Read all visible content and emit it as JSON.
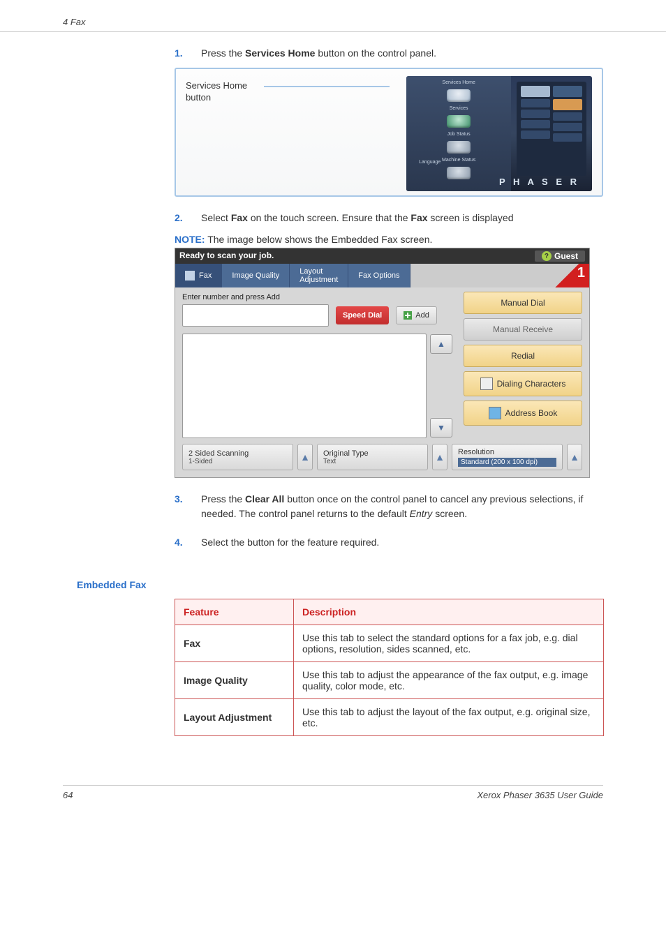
{
  "header": {
    "section": "4 Fax"
  },
  "steps": {
    "s1": {
      "num": "1.",
      "pre": "Press the ",
      "bold1": "Services Home",
      "post": " button on the control panel."
    },
    "s2": {
      "num": "2.",
      "pre": "Select ",
      "bold1": "Fax",
      "mid": " on the touch screen. Ensure that the ",
      "bold2": "Fax",
      "post": " screen is displayed"
    },
    "s3": {
      "num": "3.",
      "pre": "Press the ",
      "bold1": "Clear All",
      "mid": " button once on the control panel to cancel any previous selections, if needed. The control panel returns to the default ",
      "ital": "Entry",
      "post": " screen."
    },
    "s4": {
      "num": "4.",
      "text": "Select the button for the feature required."
    }
  },
  "photo": {
    "label_l1": "Services Home",
    "label_l2": "button",
    "panel_labels": {
      "svc_home": "Services Home",
      "services": "Services",
      "job_status": "Job Status",
      "machine_status": "Machine Status",
      "language": "Language"
    },
    "brand": "P H A S E R"
  },
  "note": {
    "label": "NOTE:",
    "text": " The image below shows the Embedded Fax screen."
  },
  "touch": {
    "ready": "Ready to scan your job.",
    "guest": "Guest",
    "tabs": {
      "fax": "Fax",
      "image_quality": "Image Quality",
      "layout": "Layout\nAdjustment",
      "fax_options": "Fax Options"
    },
    "count": "1",
    "enter_label": "Enter number and press Add",
    "speed_dial": "Speed Dial",
    "add": "Add",
    "side": {
      "manual_dial": "Manual Dial",
      "manual_receive": "Manual Receive",
      "redial": "Redial",
      "dialing_chars": "Dialing Characters",
      "address_book": "Address Book"
    },
    "bottom": {
      "two_sided": "2 Sided Scanning",
      "one_sided": "1-Sided",
      "orig_type": "Original Type",
      "text": "Text",
      "resolution": "Resolution",
      "res_val": "Standard (200 x 100 dpi)"
    }
  },
  "section_title": "Embedded Fax",
  "table": {
    "head": {
      "feature": "Feature",
      "desc": "Description"
    },
    "rows": [
      {
        "feature": "Fax",
        "desc": "Use this tab to select the standard options for a fax job, e.g. dial options, resolution, sides scanned, etc."
      },
      {
        "feature": "Image Quality",
        "desc": "Use this tab to adjust the appearance of the fax output, e.g. image quality, color mode, etc."
      },
      {
        "feature": "Layout Adjustment",
        "desc": "Use this tab to adjust the layout of the fax output, e.g. original size, etc."
      }
    ]
  },
  "footer": {
    "page": "64",
    "doc": "Xerox Phaser 3635 User Guide"
  }
}
